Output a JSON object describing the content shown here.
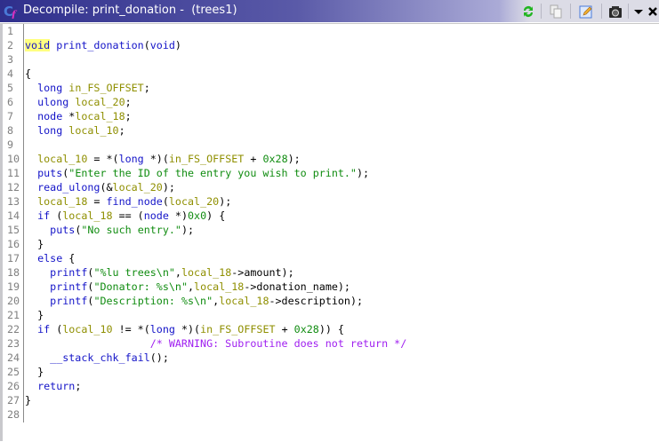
{
  "window": {
    "title": "Decompile: print_donation -  (trees1)",
    "toolbar": [
      "refresh-icon",
      "copy-icon",
      "edit-icon",
      "snapshot-icon",
      "menu-dropdown-icon",
      "close-icon"
    ]
  },
  "colors": {
    "keyword": "#1414c8",
    "variable": "#8f8f00",
    "constant": "#108c10",
    "comment": "#a020f0",
    "highlight": "#ffff80"
  },
  "code": [
    [],
    [
      [
        "kh",
        "void"
      ],
      [
        "p",
        " "
      ],
      [
        "k",
        "print_donation"
      ],
      [
        "p",
        "("
      ],
      [
        "k",
        "void"
      ],
      [
        "p",
        ")"
      ]
    ],
    [],
    [
      [
        "p",
        "{"
      ]
    ],
    [
      [
        "p",
        "  "
      ],
      [
        "k",
        "long"
      ],
      [
        "p",
        " "
      ],
      [
        "v",
        "in_FS_OFFSET"
      ],
      [
        "p",
        ";"
      ]
    ],
    [
      [
        "p",
        "  "
      ],
      [
        "k",
        "ulong"
      ],
      [
        "p",
        " "
      ],
      [
        "v",
        "local_20"
      ],
      [
        "p",
        ";"
      ]
    ],
    [
      [
        "p",
        "  "
      ],
      [
        "k",
        "node"
      ],
      [
        "p",
        " *"
      ],
      [
        "v",
        "local_18"
      ],
      [
        "p",
        ";"
      ]
    ],
    [
      [
        "p",
        "  "
      ],
      [
        "k",
        "long"
      ],
      [
        "p",
        " "
      ],
      [
        "v",
        "local_10"
      ],
      [
        "p",
        ";"
      ]
    ],
    [],
    [
      [
        "p",
        "  "
      ],
      [
        "v",
        "local_10"
      ],
      [
        "p",
        " = *("
      ],
      [
        "k",
        "long"
      ],
      [
        "p",
        " *)("
      ],
      [
        "v",
        "in_FS_OFFSET"
      ],
      [
        "p",
        " + "
      ],
      [
        "c",
        "0x28"
      ],
      [
        "p",
        ");"
      ]
    ],
    [
      [
        "p",
        "  "
      ],
      [
        "k",
        "puts"
      ],
      [
        "p",
        "("
      ],
      [
        "c",
        "\"Enter the ID of the entry you wish to print.\""
      ],
      [
        "p",
        ");"
      ]
    ],
    [
      [
        "p",
        "  "
      ],
      [
        "k",
        "read_ulong"
      ],
      [
        "p",
        "(&"
      ],
      [
        "v",
        "local_20"
      ],
      [
        "p",
        ");"
      ]
    ],
    [
      [
        "p",
        "  "
      ],
      [
        "v",
        "local_18"
      ],
      [
        "p",
        " = "
      ],
      [
        "k",
        "find_node"
      ],
      [
        "p",
        "("
      ],
      [
        "v",
        "local_20"
      ],
      [
        "p",
        ");"
      ]
    ],
    [
      [
        "p",
        "  "
      ],
      [
        "k",
        "if"
      ],
      [
        "p",
        " ("
      ],
      [
        "v",
        "local_18"
      ],
      [
        "p",
        " == ("
      ],
      [
        "k",
        "node"
      ],
      [
        "p",
        " *)"
      ],
      [
        "c",
        "0x0"
      ],
      [
        "p",
        ") {"
      ]
    ],
    [
      [
        "p",
        "    "
      ],
      [
        "k",
        "puts"
      ],
      [
        "p",
        "("
      ],
      [
        "c",
        "\"No such entry.\""
      ],
      [
        "p",
        ");"
      ]
    ],
    [
      [
        "p",
        "  }"
      ]
    ],
    [
      [
        "p",
        "  "
      ],
      [
        "k",
        "else"
      ],
      [
        "p",
        " {"
      ]
    ],
    [
      [
        "p",
        "    "
      ],
      [
        "k",
        "printf"
      ],
      [
        "p",
        "("
      ],
      [
        "c",
        "\"%lu trees\\n\""
      ],
      [
        "p",
        ","
      ],
      [
        "v",
        "local_18"
      ],
      [
        "p",
        "->amount);"
      ]
    ],
    [
      [
        "p",
        "    "
      ],
      [
        "k",
        "printf"
      ],
      [
        "p",
        "("
      ],
      [
        "c",
        "\"Donator: %s\\n\""
      ],
      [
        "p",
        ","
      ],
      [
        "v",
        "local_18"
      ],
      [
        "p",
        "->donation_name);"
      ]
    ],
    [
      [
        "p",
        "    "
      ],
      [
        "k",
        "printf"
      ],
      [
        "p",
        "("
      ],
      [
        "c",
        "\"Description: %s\\n\""
      ],
      [
        "p",
        ","
      ],
      [
        "v",
        "local_18"
      ],
      [
        "p",
        "->description);"
      ]
    ],
    [
      [
        "p",
        "  }"
      ]
    ],
    [
      [
        "p",
        "  "
      ],
      [
        "k",
        "if"
      ],
      [
        "p",
        " ("
      ],
      [
        "v",
        "local_10"
      ],
      [
        "p",
        " != *("
      ],
      [
        "k",
        "long"
      ],
      [
        "p",
        " *)("
      ],
      [
        "v",
        "in_FS_OFFSET"
      ],
      [
        "p",
        " + "
      ],
      [
        "c",
        "0x28"
      ],
      [
        "p",
        ")) {"
      ]
    ],
    [
      [
        "p",
        "                    "
      ],
      [
        "m",
        "/* WARNING: Subroutine does not return */"
      ]
    ],
    [
      [
        "p",
        "    "
      ],
      [
        "k",
        "__stack_chk_fail"
      ],
      [
        "p",
        "();"
      ]
    ],
    [
      [
        "p",
        "  }"
      ]
    ],
    [
      [
        "p",
        "  "
      ],
      [
        "k",
        "return"
      ],
      [
        "p",
        ";"
      ]
    ],
    [
      [
        "p",
        "}"
      ]
    ],
    []
  ]
}
